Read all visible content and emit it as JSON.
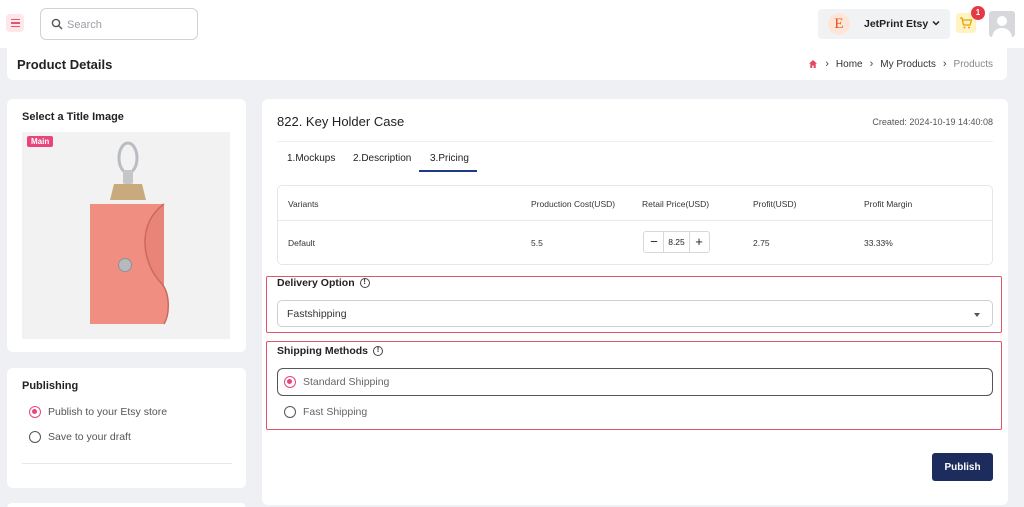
{
  "header": {
    "search_placeholder": "Search",
    "store_initial": "E",
    "store_name": "JetPrint Etsy",
    "cart_count": "1"
  },
  "title_bar": {
    "title": "Product Details",
    "breadcrumbs": [
      "Home",
      "My Products",
      "Products"
    ]
  },
  "image_panel": {
    "heading": "Select a Title Image",
    "main_tag": "Main"
  },
  "publishing": {
    "heading": "Publishing",
    "options": [
      {
        "label": "Publish to your Etsy store",
        "selected": true
      },
      {
        "label": "Save to your draft",
        "selected": false
      }
    ]
  },
  "product": {
    "title": "822. Key Holder Case",
    "created": "Created: 2024-10-19 14:40:08",
    "tabs": [
      "1.Mockups",
      "2.Description",
      "3.Pricing"
    ],
    "active_tab": "3.Pricing"
  },
  "pricing_table": {
    "columns": [
      "Variants",
      "Production Cost(USD)",
      "Retail Price(USD)",
      "Profit(USD)",
      "Profit Margin"
    ],
    "rows": [
      {
        "variant": "Default",
        "production_cost": "5.5",
        "retail_price": "8.25",
        "profit": "2.75",
        "profit_margin": "33.33%"
      }
    ]
  },
  "delivery": {
    "heading": "Delivery Option",
    "selected": "Fastshipping"
  },
  "shipping": {
    "heading": "Shipping Methods",
    "options": [
      {
        "label": "Standard Shipping",
        "selected": true
      },
      {
        "label": "Fast Shipping",
        "selected": false
      }
    ]
  },
  "actions": {
    "publish_label": "Publish"
  },
  "colors": {
    "accent_pink": "#e9457a",
    "highlight_red": "#e05569",
    "primary_navy": "#1c2c5c",
    "product_coral": "#ee8a80"
  }
}
